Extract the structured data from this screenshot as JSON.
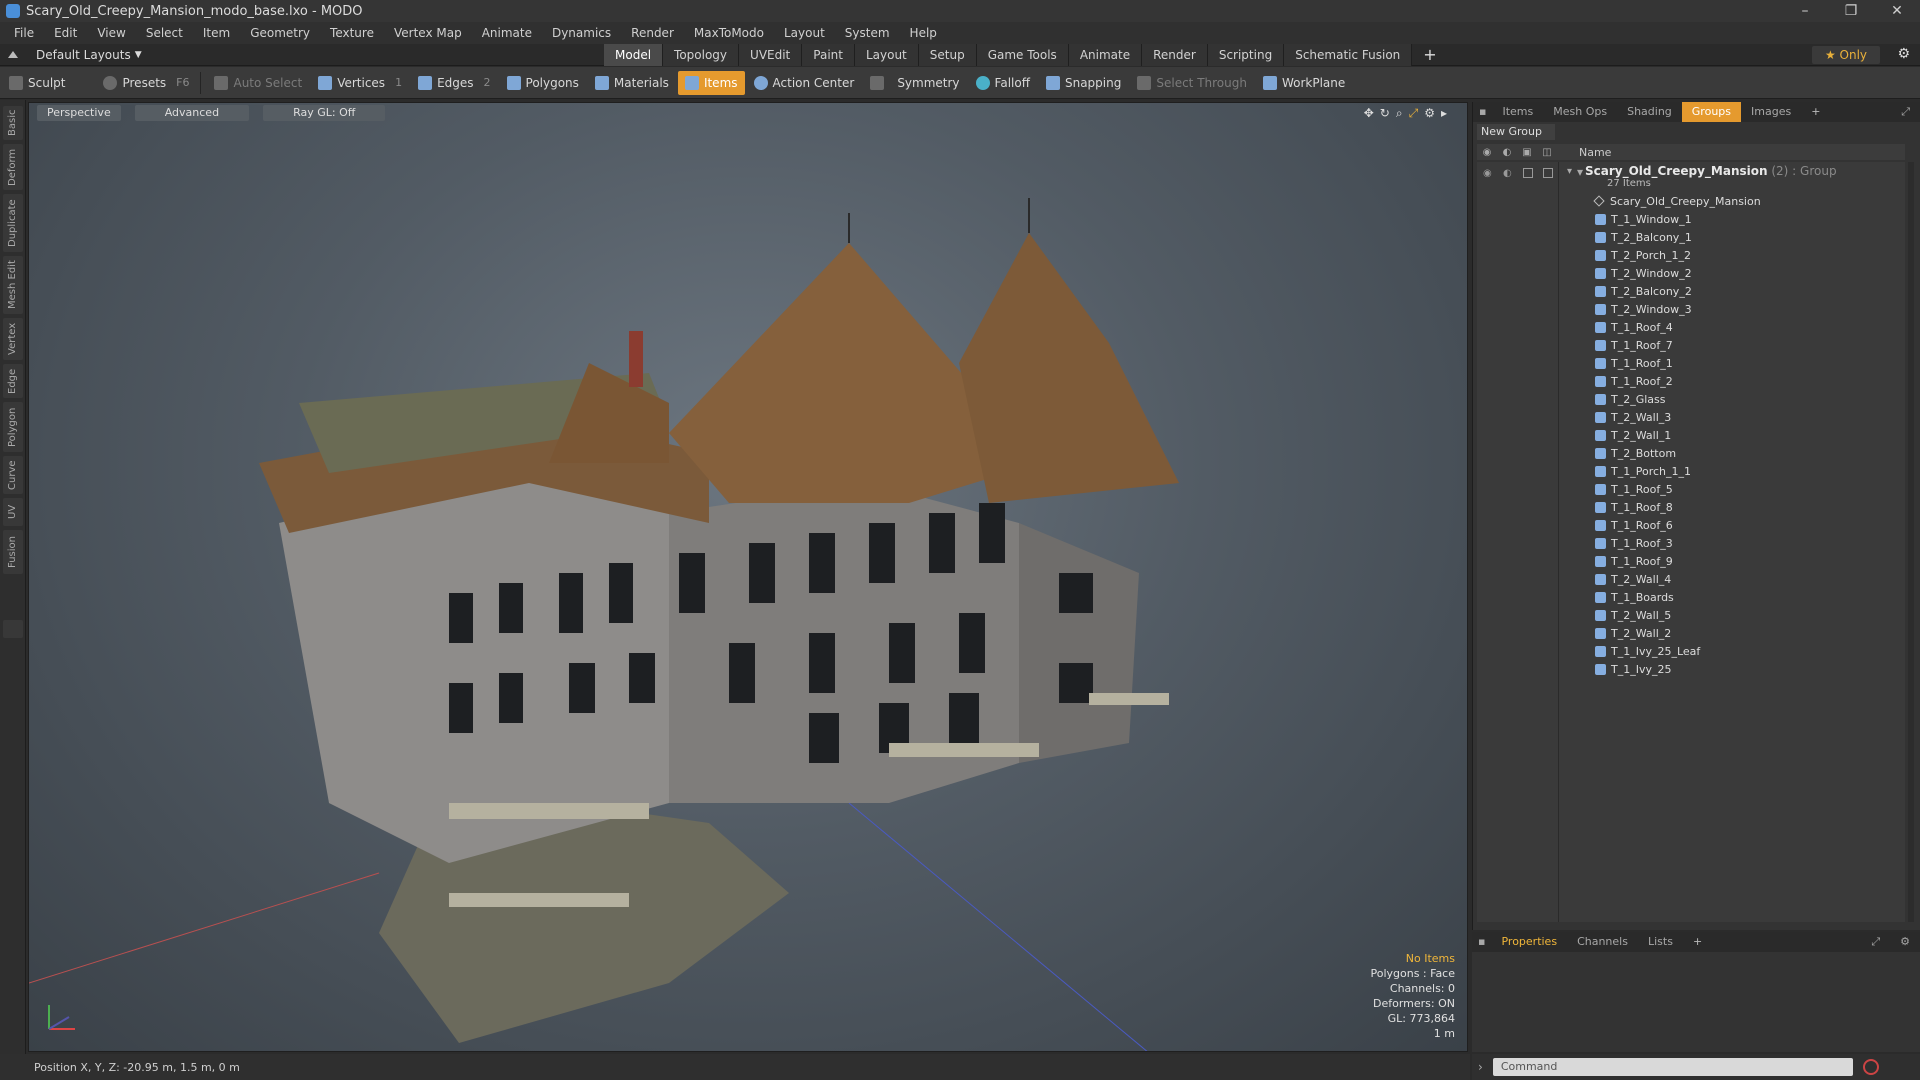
{
  "window": {
    "title": "Scary_Old_Creepy_Mansion_modo_base.lxo - MODO"
  },
  "menu": [
    "File",
    "Edit",
    "View",
    "Select",
    "Item",
    "Geometry",
    "Texture",
    "Vertex Map",
    "Animate",
    "Dynamics",
    "Render",
    "MaxToModo",
    "Layout",
    "System",
    "Help"
  ],
  "layout": {
    "default_layouts": "Default Layouts",
    "tabs": [
      "Model",
      "Topology",
      "UVEdit",
      "Paint",
      "Layout",
      "Setup",
      "Game Tools",
      "Animate",
      "Render",
      "Scripting",
      "Schematic Fusion"
    ],
    "active_tab": "Model",
    "only_label": "Only"
  },
  "toolbar": {
    "sculpt": "Sculpt",
    "presets": "Presets",
    "presets_key": "F6",
    "auto_select": "Auto Select",
    "vertices": "Vertices",
    "vertices_count": "1",
    "edges": "Edges",
    "edges_count": "2",
    "polygons": "Polygons",
    "materials": "Materials",
    "items": "Items",
    "action_center": "Action Center",
    "symmetry": "Symmetry",
    "falloff": "Falloff",
    "snapping": "Snapping",
    "select_through": "Select Through",
    "workplane": "WorkPlane"
  },
  "left_tabs": [
    "Basic",
    "Deform",
    "Duplicate",
    "Mesh Edit",
    "Vertex",
    "Edge",
    "Polygon",
    "Curve",
    "UV",
    "Fusion"
  ],
  "viewport": {
    "perspective": "Perspective",
    "advanced": "Advanced",
    "raygl": "Ray GL: Off",
    "info": {
      "items": "No Items",
      "polygons": "Polygons : Face",
      "channels": "Channels: 0",
      "deformers": "Deformers: ON",
      "gl": "GL: 773,864",
      "scale": "1 m"
    }
  },
  "status": {
    "position": "Position X, Y, Z:  -20.95 m, 1.5 m, 0 m"
  },
  "right_panel": {
    "tabs": [
      "Items",
      "Mesh Ops",
      "Shading",
      "Groups",
      "Images"
    ],
    "active_tab": "Groups",
    "new_group": "New Group",
    "name_header": "Name",
    "root_name": "Scary_Old_Creepy_Mansion",
    "root_suffix": " (2) : Group",
    "root_count": "27 Items",
    "items": [
      "Scary_Old_Creepy_Mansion",
      "T_1_Window_1",
      "T_2_Balcony_1",
      "T_2_Porch_1_2",
      "T_2_Window_2",
      "T_2_Balcony_2",
      "T_2_Window_3",
      "T_1_Roof_4",
      "T_1_Roof_7",
      "T_1_Roof_1",
      "T_1_Roof_2",
      "T_2_Glass",
      "T_2_Wall_3",
      "T_2_Wall_1",
      "T_2_Bottom",
      "T_1_Porch_1_1",
      "T_1_Roof_5",
      "T_1_Roof_8",
      "T_1_Roof_6",
      "T_1_Roof_3",
      "T_1_Roof_9",
      "T_2_Wall_4",
      "T_1_Boards",
      "T_2_Wall_5",
      "T_2_Wall_2",
      "T_1_Ivy_25_Leaf",
      "T_1_Ivy_25"
    ]
  },
  "bottom_panel": {
    "tabs": [
      "Properties",
      "Channels",
      "Lists"
    ],
    "active_tab": "Properties"
  },
  "command": {
    "placeholder": "Command"
  }
}
